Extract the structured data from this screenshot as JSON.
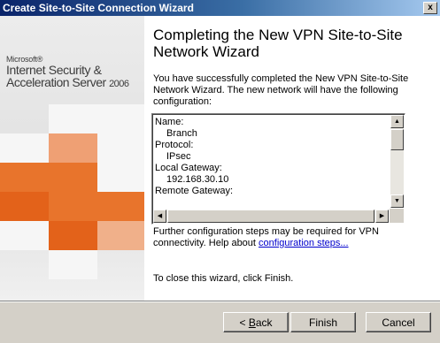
{
  "window": {
    "title": "Create Site-to-Site Connection Wizard",
    "close_glyph": "x"
  },
  "banner": {
    "brand_microsoft": "Microsoft®",
    "brand_line1": "Internet Security &",
    "brand_line2": "Acceleration Server",
    "brand_year": "2006",
    "tile_colors": [
      "#f6f6f6",
      "#efa074",
      "#e8742c",
      "#e3621a",
      "#f0b08a"
    ]
  },
  "content": {
    "heading": "Completing the New VPN Site-to-Site Network Wizard",
    "intro": "You have successfully completed the New VPN Site-to-Site Network Wizard. The new network will have the following configuration:",
    "config_lines": [
      {
        "text": "Name:",
        "indent": false
      },
      {
        "text": "Branch",
        "indent": true
      },
      {
        "text": "Protocol:",
        "indent": false
      },
      {
        "text": "IPsec",
        "indent": true
      },
      {
        "text": "Local Gateway:",
        "indent": false
      },
      {
        "text": "192.168.30.10",
        "indent": true
      },
      {
        "text": "Remote Gateway:",
        "indent": false
      }
    ],
    "note_prefix": "Further configuration steps may be required for VPN connectivity. Help about ",
    "note_link": "configuration steps...",
    "closing": "To close this wizard, click Finish."
  },
  "buttons": {
    "back_arrow": "< ",
    "back_mnemonic": "B",
    "back_rest": "ack",
    "finish": "Finish",
    "cancel": "Cancel"
  },
  "scroll_glyphs": {
    "up": "▲",
    "down": "▼",
    "left": "◀",
    "right": "▶"
  }
}
